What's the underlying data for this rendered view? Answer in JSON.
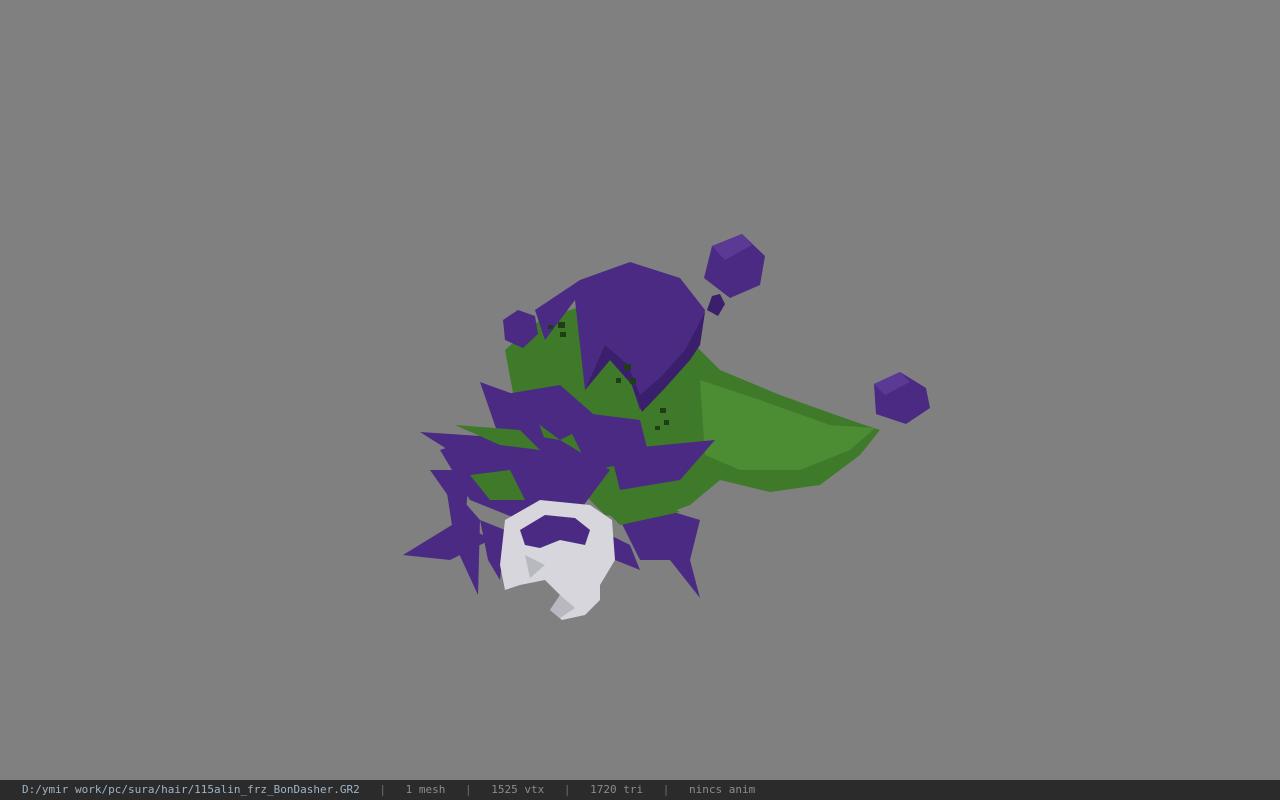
{
  "viewer": {
    "background_color": "#808080",
    "model_colors": {
      "purple": "#4a2a82",
      "purple_dark": "#34195f",
      "green": "#3f7a2a",
      "green_dark": "#2c5a1e",
      "mask": "#d6d6dc"
    }
  },
  "status": {
    "path": "D:/ymir work/pc/sura/hair/115alin_frz_BonDasher.GR2",
    "sep": "|",
    "mesh": "1 mesh",
    "vtx": "1525 vtx",
    "tri": "1720 tri",
    "anim": "nincs anim"
  }
}
